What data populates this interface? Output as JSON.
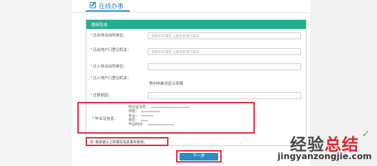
{
  "tab": {
    "label": "在线办事",
    "icon": "edit-icon"
  },
  "panel": {
    "header": "基础信息"
  },
  "form": {
    "rows": [
      {
        "label": "* 迁出地派出所单位：",
        "placeholder": "请核实并填写上面信息进行填写"
      },
      {
        "label": "* 迁出地户口登记机关：",
        "placeholder": "请核实并填写上面信息进行填写"
      },
      {
        "label": "* 迁入地派出所单位：",
        "placeholder": ""
      },
      {
        "label": "* 迁入地户口登记机关：",
        "value": "常州市新北区公安局"
      },
      {
        "label": "* 迁移原因：",
        "placeholder": ""
      }
    ],
    "graduate": {
      "label": "* 毕业证信息：",
      "lines": [
        "毕业证书号：",
        "学校：",
        "专业：",
        "学历：",
        "毕业时间："
      ]
    }
  },
  "pledge": {
    "text": "我承诺以上所填写信息真实有效。"
  },
  "next_button": {
    "label": "下一步"
  },
  "watermark": {
    "text_main": "经验",
    "text_accent": "总结",
    "url": "jingyanzongjie.com",
    "check_icon": "check-icon"
  },
  "colors": {
    "accent_blue": "#2b8cc4",
    "header_green": "#1fb08c",
    "highlight_red": "#e0283a"
  }
}
